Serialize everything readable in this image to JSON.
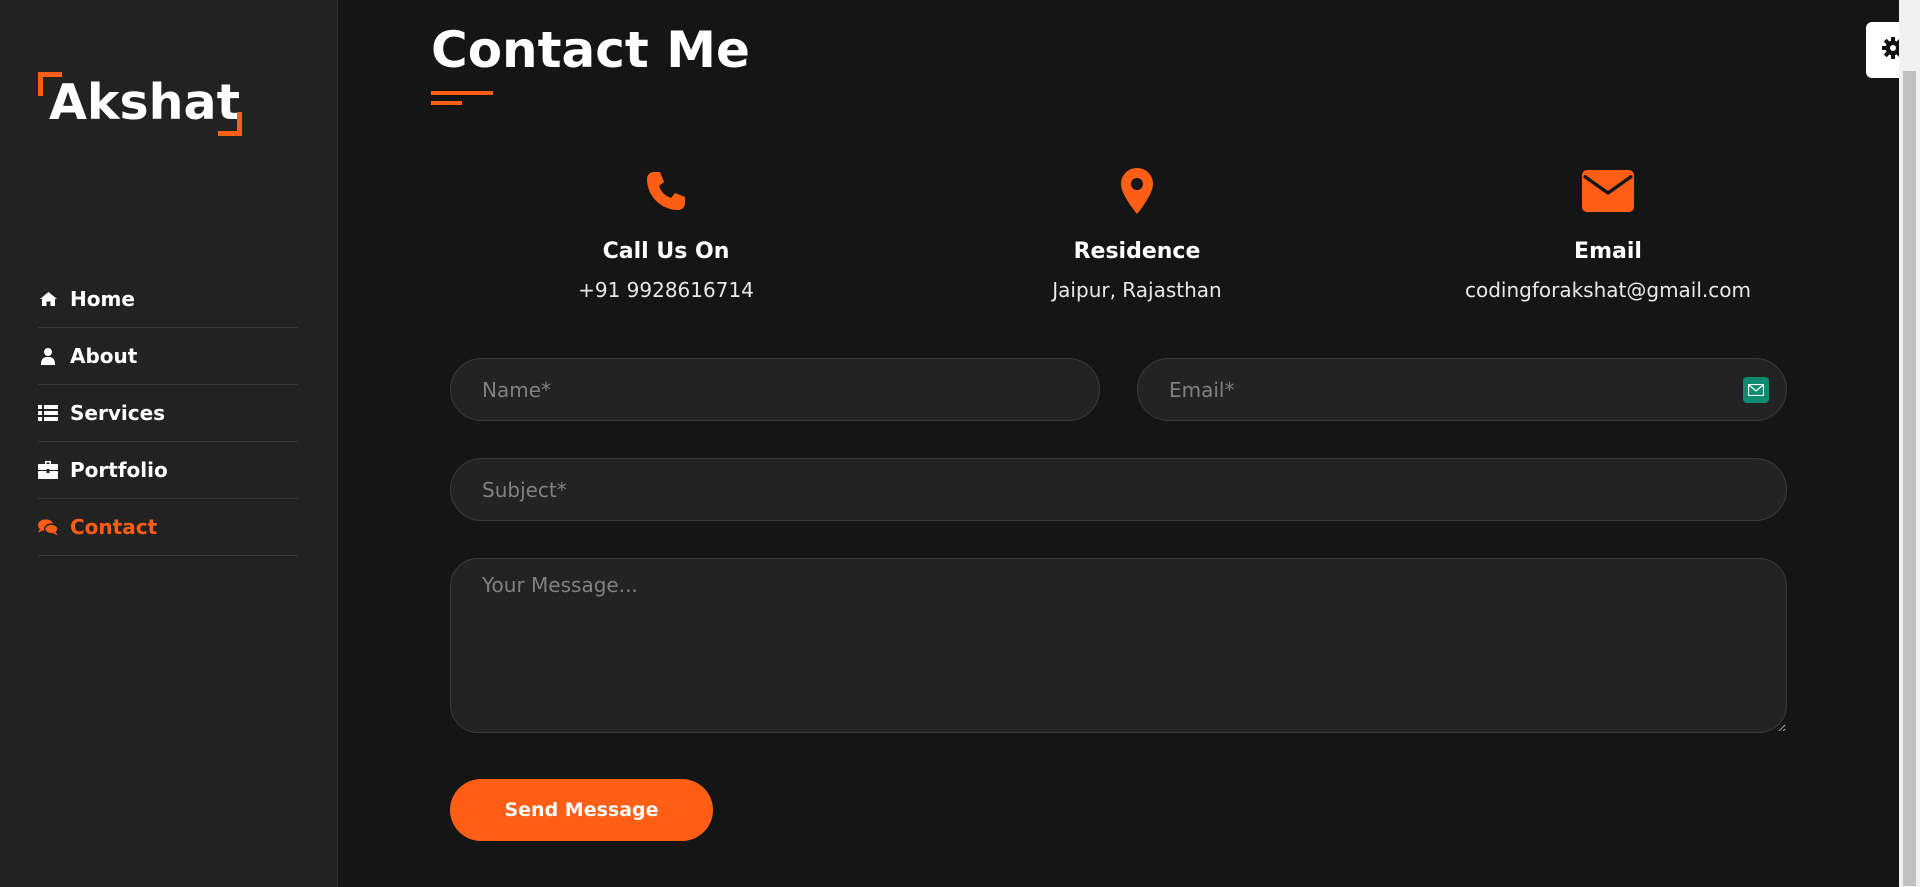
{
  "sidebar": {
    "logo_text": "Akshat",
    "items": [
      {
        "label": "Home",
        "icon": "home-icon"
      },
      {
        "label": "About",
        "icon": "user-icon"
      },
      {
        "label": "Services",
        "icon": "list-icon"
      },
      {
        "label": "Portfolio",
        "icon": "briefcase-icon"
      },
      {
        "label": "Contact",
        "icon": "comments-icon",
        "active": true
      }
    ]
  },
  "main": {
    "title": "Contact Me",
    "info": [
      {
        "title": "Call Us On",
        "value": "+91 9928616714",
        "icon": "phone-icon"
      },
      {
        "title": "Residence",
        "value": "Jaipur, Rajasthan",
        "icon": "map-marker-icon"
      },
      {
        "title": "Email",
        "value": "codingforakshat@gmail.com",
        "icon": "envelope-icon"
      }
    ],
    "form": {
      "name_placeholder": "Name*",
      "email_placeholder": "Email*",
      "subject_placeholder": "Subject*",
      "message_placeholder": "Your Message...",
      "send_label": "Send Message"
    }
  },
  "colors": {
    "accent": "#ff5e14",
    "background": "#151515",
    "sidebar": "#222222",
    "field": "#232323"
  }
}
